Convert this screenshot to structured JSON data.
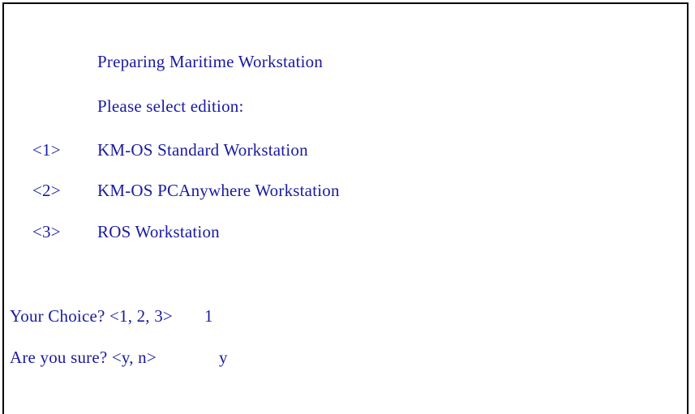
{
  "console": {
    "title": "Preparing Maritime Workstation",
    "prompt": "Please select edition:",
    "options": [
      {
        "number": "<1>",
        "label": "KM-OS Standard Workstation"
      },
      {
        "number": "<2>",
        "label": "KM-OS PCAnywhere Workstation"
      },
      {
        "number": "<3>",
        "label": "ROS Workstation"
      }
    ],
    "choice_prompt": "Your Choice? <1, 2, 3>",
    "choice_value": "1",
    "confirm_prompt": "Are you sure? <y, n>",
    "confirm_value": "y"
  },
  "colors": {
    "text": "#1a1aa0",
    "border": "#000000",
    "background": "#ffffff"
  }
}
